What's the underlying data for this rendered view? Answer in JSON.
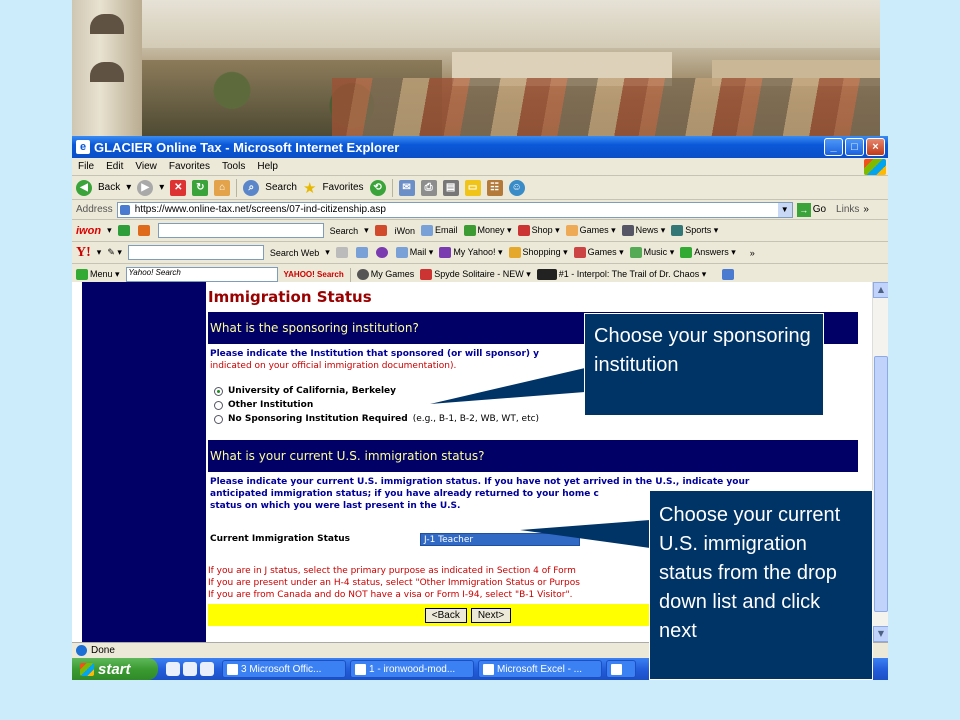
{
  "window": {
    "title": "GLACIER Online Tax - Microsoft Internet Explorer",
    "controls": [
      "_",
      "□",
      "×"
    ]
  },
  "menu": [
    "File",
    "Edit",
    "View",
    "Favorites",
    "Tools",
    "Help"
  ],
  "toolbar": {
    "back": "Back",
    "search": "Search",
    "favorites": "Favorites"
  },
  "address": {
    "label": "Address",
    "url": "https://www.online-tax.net/screens/07-ind-citizenship.asp",
    "go": "Go",
    "links": "Links",
    "more": "»"
  },
  "iwon_bar": {
    "brand": "iwon",
    "search": "Search",
    "items": [
      "iWon",
      "Email",
      "Money",
      "Shop",
      "Games",
      "News",
      "Sports"
    ]
  },
  "yahoo_bar": {
    "brand": "Y!",
    "search": "Search Web",
    "items": [
      "Mail",
      "My Yahoo!",
      "Shopping",
      "Games",
      "Music",
      "Answers"
    ],
    "more": "»"
  },
  "third_bar": {
    "menu": "Menu",
    "search_placeholder": "Yahoo! Search",
    "yahoo_search": "YAHOO! Search",
    "items": [
      "My Games",
      "Spyde Solitaire - NEW",
      "#1 - Interpol: The Trail of Dr. Chaos"
    ]
  },
  "page": {
    "heading": "Immigration Status",
    "section1_title": "What is the sponsoring institution?",
    "section1_instr_line1": "Please indicate the Institution that sponsored (or will sponsor) y",
    "section1_instr_line2": "indicated on your official immigration documentation).",
    "options": [
      {
        "label": "University of California, Berkeley",
        "extra": "",
        "selected": true
      },
      {
        "label": "Other Institution",
        "extra": "",
        "selected": false
      },
      {
        "label": "No Sponsoring Institution Required",
        "extra": "(e.g., B-1, B-2, WB, WT, etc)",
        "selected": false
      }
    ],
    "section2_title": "What is your current U.S. immigration status?",
    "section2_instr_line1": "Please indicate your current U.S. immigration status. If you have not yet arrived in the U.S., indicate your",
    "section2_instr_line2": "anticipated immigration status; if you have already returned to your home c",
    "section2_instr_line3": "status on which you were last present in the U.S.",
    "status_label": "Current Immigration Status",
    "status_value": "J-1 Teacher",
    "notes": [
      "If you are in J status, select the primary purpose as indicated in Section 4 of Form",
      "If you are present under an H-4 status, select \"Other Immigration Status or Purpos",
      "If you are from Canada and do NOT have a visa or Form I-94, select \"B-1 Visitor\"."
    ],
    "back_button": "<Back",
    "next_button": "Next>"
  },
  "status_bar": {
    "text": "Done"
  },
  "taskbar": {
    "start": "start",
    "tasks": [
      "3 Microsoft Offic...",
      "1 - ironwood-mod...",
      "Microsoft Excel - ..."
    ]
  },
  "callouts": {
    "first": "Choose your sponsoring institution",
    "second": "Choose your current U.S. immigration status from the drop down list and click next"
  },
  "colors": {
    "background": "#ccecfb",
    "callout": "#003366",
    "section_bar": "#000066",
    "heading": "#990000",
    "button_bar": "#ffff00"
  }
}
